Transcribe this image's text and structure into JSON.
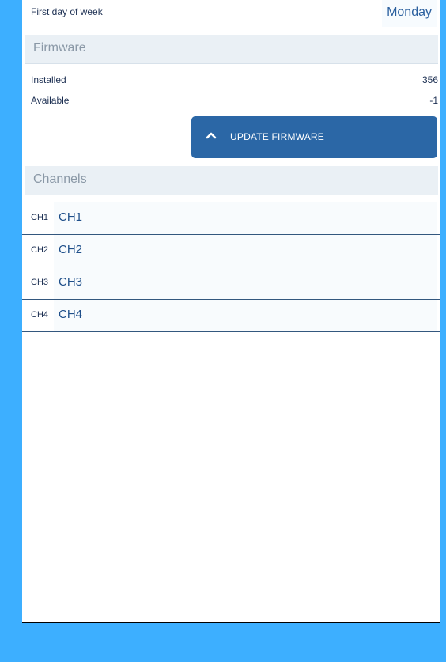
{
  "settings": {
    "first_day_of_week": {
      "label": "First day of week",
      "value": "Monday"
    }
  },
  "firmware": {
    "header": "Firmware",
    "installed_label": "Installed",
    "installed_value": "356",
    "available_label": "Available",
    "available_value": "-1",
    "update_button_label": "UPDATE FIRMWARE",
    "update_button_icon": "chevron-up-icon"
  },
  "channels": {
    "header": "Channels",
    "items": [
      {
        "tag": "CH1",
        "name": "CH1"
      },
      {
        "tag": "CH2",
        "name": "CH2"
      },
      {
        "tag": "CH3",
        "name": "CH3"
      },
      {
        "tag": "CH4",
        "name": "CH4"
      }
    ]
  },
  "colors": {
    "frame_accent": "#3dafff",
    "primary_button": "#2b67a6",
    "section_header_bg": "#eaf0f5",
    "divider": "#33577e"
  }
}
